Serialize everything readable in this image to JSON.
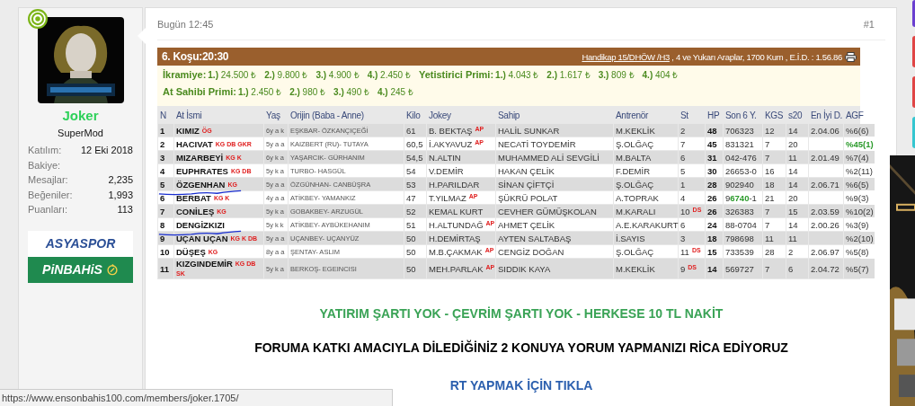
{
  "user": {
    "online": true,
    "name": "Joker",
    "role": "SuperMod",
    "stats": [
      {
        "label": "Katılım:",
        "value": "12 Eki 2018"
      },
      {
        "label": "Bakiye:"
      },
      {
        "label": "Mesajlar:",
        "value": "2,235"
      },
      {
        "label": "Beğeniler:",
        "value": "1,993"
      },
      {
        "label": "Puanları:",
        "value": "113"
      }
    ],
    "banners": [
      {
        "kind": "asyaspor",
        "text": "ASYASPOR"
      },
      {
        "kind": "pinbahis",
        "text": "PiNBAHiS"
      }
    ]
  },
  "post": {
    "time": "Bugün 12:45",
    "number": "#1"
  },
  "race": {
    "title": "6. Koşu:20:30",
    "link": "Handikap 15/DHÖW /H3",
    "info": " , 4 ve Yukarı Araplar, 1700 Kum , E.İ.D. : 1.56.86",
    "prize_lines": [
      [
        {
          "label": "İkramiye:",
          "items": [
            {
              "place": "1.)",
              "amount": "24.500 ₺"
            },
            {
              "place": "2.)",
              "amount": "9.800 ₺"
            },
            {
              "place": "3.)",
              "amount": "4.900 ₺"
            },
            {
              "place": "4.)",
              "amount": "2.450 ₺"
            }
          ]
        },
        {
          "label": "Yetistirici Primi:",
          "items": [
            {
              "place": "1.)",
              "amount": "4.043 ₺"
            },
            {
              "place": "2.)",
              "amount": "1.617 ₺"
            },
            {
              "place": "3.)",
              "amount": "809 ₺"
            },
            {
              "place": "4.)",
              "amount": "404 ₺"
            }
          ]
        }
      ],
      [
        {
          "label": "At Sahibi Primi:",
          "items": [
            {
              "place": "1.)",
              "amount": "2.450 ₺"
            },
            {
              "place": "2.)",
              "amount": "980 ₺"
            },
            {
              "place": "3.)",
              "amount": "490 ₺"
            },
            {
              "place": "4.)",
              "amount": "245 ₺"
            }
          ]
        }
      ]
    ],
    "columns": [
      "N",
      "At İsmi",
      "Yaş",
      "Orijin (Baba - Anne)",
      "Kilo",
      "Jokey",
      "Sahip",
      "Antrenör",
      "St",
      "HP",
      "Son 6 Y.",
      "KGS",
      "s20",
      "En İyi D.",
      "AGF"
    ],
    "rows": [
      {
        "n": "1",
        "name": "KIMIZ",
        "tags": "ÖG",
        "age": "6y a k",
        "origin": "EŞKBAR- ÖZKANÇIÇEĞİ",
        "kilo": "61",
        "jockey": "B. BEKTAŞ",
        "jockey_tag": "AP",
        "owner": "HALİL SUNKAR",
        "trainer": "M.KEKLİK",
        "st": "2",
        "st_tag": "",
        "hp": "48",
        "last6": "706323",
        "kgs": "12",
        "s20": "14",
        "best": "2.04.06",
        "agf": "%6(6)",
        "favorite": false,
        "underlined": false
      },
      {
        "n": "2",
        "name": "HACIVAT",
        "tags": "KG DB GKR",
        "age": "5y a a",
        "origin": "KAIZBERT (RU)- TUTAYA",
        "kilo": "60,5",
        "jockey": "İ.AKYAVUZ",
        "jockey_tag": "AP",
        "owner": "NECATİ TOYDEMİR",
        "trainer": "Ş.OLĞAÇ",
        "st": "7",
        "st_tag": "",
        "hp": "45",
        "last6": "831321",
        "kgs": "7",
        "s20": "20",
        "best": "",
        "agf": "%45(1)",
        "favorite": true,
        "underlined": false
      },
      {
        "n": "3",
        "name": "MIZARBEYİ",
        "tags": "KG K",
        "age": "6y k a",
        "origin": "YAŞARCIK- GÜRHANIM",
        "kilo": "54,5",
        "jockey": "N.ALTIN",
        "jockey_tag": "",
        "owner": "MUHAMMED ALİ SEVGİLİ",
        "trainer": "M.BALTA",
        "st": "6",
        "st_tag": "",
        "hp": "31",
        "last6": "042-476",
        "kgs": "7",
        "s20": "11",
        "best": "2.01.49",
        "agf": "%7(4)",
        "favorite": false,
        "underlined": false
      },
      {
        "n": "4",
        "name": "EUPHRATES",
        "tags": "KG DB",
        "age": "5y k a",
        "origin": "TURBO- HASGÜL",
        "kilo": "54",
        "jockey": "V.DEMİR",
        "jockey_tag": "",
        "owner": "HAKAN ÇELİK",
        "trainer": "F.DEMİR",
        "st": "5",
        "st_tag": "",
        "hp": "30",
        "last6": "26653-0",
        "kgs": "16",
        "s20": "14",
        "best": "",
        "agf": "%2(11)",
        "favorite": false,
        "underlined": false
      },
      {
        "n": "5",
        "name": "ÖZGENHAN",
        "tags": "KG",
        "age": "5y a a",
        "origin": "ÖZGÜNHAN- CANBÜŞRA",
        "kilo": "53",
        "jockey": "H.PARILDAR",
        "jockey_tag": "",
        "owner": "SİNAN ÇİFTÇİ",
        "trainer": "Ş.OLĞAÇ",
        "st": "1",
        "st_tag": "",
        "hp": "28",
        "last6": "902940",
        "kgs": "18",
        "s20": "14",
        "best": "2.06.71",
        "agf": "%6(5)",
        "favorite": false,
        "underlined": true
      },
      {
        "n": "6",
        "name": "BERBAT",
        "tags": "KG K",
        "age": "4y a a",
        "origin": "ATİKBEY- YAMANKIZ",
        "kilo": "47",
        "jockey": "T.YILMAZ",
        "jockey_tag": "AP",
        "owner": "ŞÜKRÜ POLAT",
        "trainer": "A.TOPRAK",
        "st": "4",
        "st_tag": "",
        "hp": "26",
        "last6": "9**6740**-1",
        "kgs": "21",
        "s20": "20",
        "best": "",
        "agf": "%9(3)",
        "favorite": false,
        "underlined": false
      },
      {
        "n": "7",
        "name": "CONİLEŞ",
        "tags": "KG",
        "age": "5y k a",
        "origin": "GOBAKBEY- ARZUGÜL",
        "kilo": "52",
        "jockey": "KEMAL KURT",
        "jockey_tag": "",
        "owner": "CEVHER GÜMÜŞKOLAN",
        "trainer": "M.KARALI",
        "st": "10",
        "st_tag": "DS",
        "hp": "26",
        "last6": "326383",
        "kgs": "7",
        "s20": "15",
        "best": "2.03.59",
        "agf": "%10(2)",
        "favorite": false,
        "underlined": false
      },
      {
        "n": "8",
        "name": "DENGİZKIZI",
        "tags": "",
        "age": "5y k k",
        "origin": "ATİKBEY- AYBÜKEHANIM",
        "kilo": "51",
        "jockey": "H.ALTUNDAĞ",
        "jockey_tag": "AP",
        "owner": "AHMET ÇELİK",
        "trainer": "A.E.KARAKURT",
        "st": "6",
        "st_tag": "",
        "hp": "24",
        "last6": "88-0704",
        "kgs": "7",
        "s20": "14",
        "best": "2.00.26",
        "agf": "%3(9)",
        "favorite": false,
        "underlined": true
      },
      {
        "n": "9",
        "name": "UÇAN UÇAN",
        "tags": "KG K DB",
        "age": "5y a a",
        "origin": "UÇANBEY- UÇANYÜZ",
        "kilo": "50",
        "jockey": "H.DEMİRTAŞ",
        "jockey_tag": "",
        "owner": "AYTEN SALTABAŞ",
        "trainer": "İ.SAYIS",
        "st": "3",
        "st_tag": "",
        "hp": "18",
        "last6": "798698",
        "kgs": "11",
        "s20": "11",
        "best": "",
        "agf": "%2(10)",
        "favorite": false,
        "underlined": false
      },
      {
        "n": "10",
        "name": "DÜŞEŞ",
        "tags": "KG",
        "age": "8y a a",
        "origin": "ŞENTAY- ASLIM",
        "kilo": "50",
        "jockey": "M.B.ÇAKMAK",
        "jockey_tag": "AP",
        "owner": "CENGİZ DOĞAN",
        "trainer": "Ş.OLĞAÇ",
        "st": "11",
        "st_tag": "DS",
        "hp": "15",
        "last6": "733539",
        "kgs": "28",
        "s20": "2",
        "best": "2.06.97",
        "agf": "%5(8)",
        "favorite": false,
        "underlined": false
      },
      {
        "n": "11",
        "name": "KIZGINDEMİR",
        "tags": "KG DB SK",
        "age": "5y k a",
        "origin": "BERKOŞ- EGEINCISI",
        "kilo": "50",
        "jockey": "MEH.PARLAK",
        "jockey_tag": "AP",
        "owner": "SIDDIK KAYA",
        "trainer": "M.KEKLİK",
        "st": "9",
        "st_tag": "DS",
        "hp": "14",
        "last6": "569727",
        "kgs": "7",
        "s20": "6",
        "best": "2.04.72",
        "agf": "%5(7)",
        "favorite": false,
        "underlined": false
      }
    ]
  },
  "notices": [
    {
      "kind": "green",
      "text": "YATIRIM ŞARTI YOK - ÇEVRİM ŞARTI YOK - HERKESE 10 TL NAKİT"
    },
    {
      "kind": "plain",
      "text": "FORUMA KATKI AMACIYLA DİLEDİĞİNİZ 2 KONUYA YORUM YAPMANIZI RİCA EDİYORUZ"
    },
    {
      "kind": "link",
      "text": "RT YAPMAK İÇİN TIKLA"
    }
  ],
  "status_url": "https://www.ensonbahis100.com/members/joker.1705/"
}
